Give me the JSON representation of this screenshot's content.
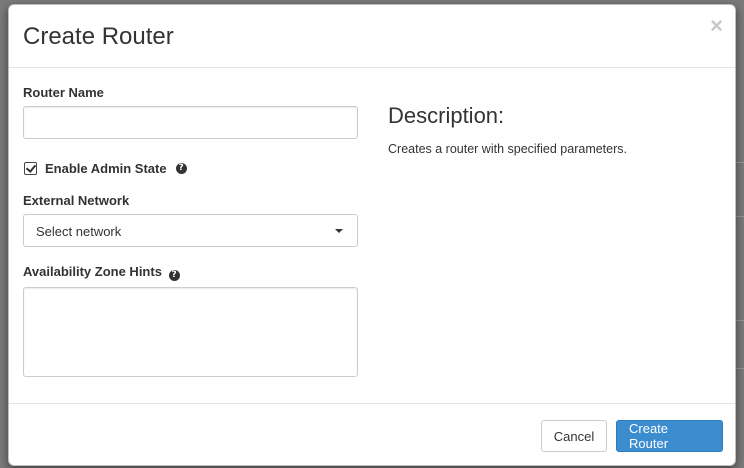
{
  "modal": {
    "title": "Create Router",
    "close_glyph": "×"
  },
  "form": {
    "router_name": {
      "label": "Router Name",
      "value": "",
      "placeholder": ""
    },
    "admin_state": {
      "label": "Enable Admin State",
      "checked": true,
      "help_glyph": "?"
    },
    "external_network": {
      "label": "External Network",
      "selected": "Select network"
    },
    "az_hints": {
      "label": "Availability Zone Hints",
      "value": "",
      "help_glyph": "?"
    }
  },
  "description": {
    "title": "Description:",
    "text": "Creates a router with specified parameters."
  },
  "footer": {
    "cancel_label": "Cancel",
    "submit_label": "Create Router"
  },
  "colors": {
    "primary": "#3c8dd0",
    "backdrop": "#7a7a7a"
  }
}
